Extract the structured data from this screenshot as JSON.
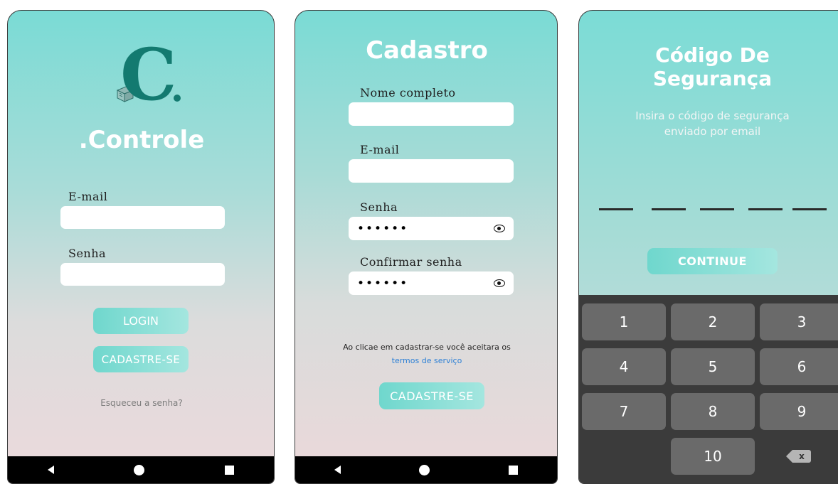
{
  "login": {
    "logo_letter": "C",
    "app_name": ".Controle",
    "email_label": "E-mail",
    "email_value": "",
    "password_label": "Senha",
    "password_value": "",
    "login_button": "LOGIN",
    "signup_button": "CADASTRE-SE",
    "forgot_link": "Esqueceu a senha?"
  },
  "register": {
    "title": "Cadastro",
    "name_label": "Nome completo",
    "name_value": "",
    "email_label": "E-mail",
    "email_value": "",
    "password_label": "Senha",
    "password_mask": "••••••",
    "confirm_label": "Confirmar senha",
    "confirm_mask": "••••••",
    "terms_text": "Ao  clicae em cadastrar-se você aceitara os",
    "terms_link": "termos de serviço",
    "submit_button": "CADASTRE-SE"
  },
  "code": {
    "title_line1": "Código De",
    "title_line2": "Segurança",
    "subtitle_line1": "Insira o código de segurança",
    "subtitle_line2": "enviado por email",
    "continue_button": "CONTINUE",
    "keys": [
      "1",
      "2",
      "3",
      "4",
      "5",
      "6",
      "7",
      "8",
      "9",
      "10"
    ]
  },
  "colors": {
    "logo": "#137a70",
    "button": "#6fd7cd",
    "link": "#2d80d6",
    "keypad": "#3b3b3b",
    "key": "#6a6a6a"
  },
  "icons": {
    "eye": "eye-icon",
    "back": "nav-back-icon",
    "home": "nav-home-icon",
    "recent": "nav-recent-icon",
    "backspace": "backspace-icon"
  }
}
